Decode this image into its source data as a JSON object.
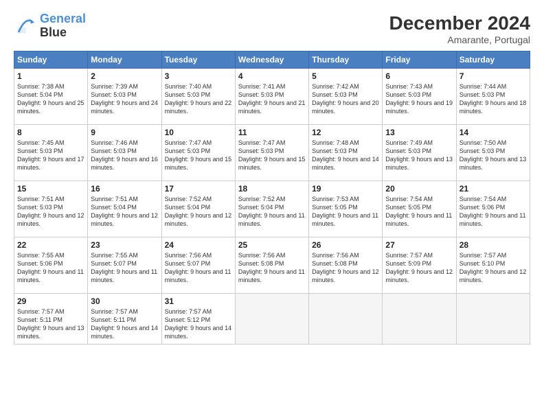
{
  "header": {
    "logo_line1": "General",
    "logo_line2": "Blue",
    "month": "December 2024",
    "location": "Amarante, Portugal"
  },
  "weekdays": [
    "Sunday",
    "Monday",
    "Tuesday",
    "Wednesday",
    "Thursday",
    "Friday",
    "Saturday"
  ],
  "weeks": [
    [
      {
        "day": "1",
        "sunrise": "7:38 AM",
        "sunset": "5:04 PM",
        "daylight": "9 hours and 25 minutes."
      },
      {
        "day": "2",
        "sunrise": "7:39 AM",
        "sunset": "5:03 PM",
        "daylight": "9 hours and 24 minutes."
      },
      {
        "day": "3",
        "sunrise": "7:40 AM",
        "sunset": "5:03 PM",
        "daylight": "9 hours and 22 minutes."
      },
      {
        "day": "4",
        "sunrise": "7:41 AM",
        "sunset": "5:03 PM",
        "daylight": "9 hours and 21 minutes."
      },
      {
        "day": "5",
        "sunrise": "7:42 AM",
        "sunset": "5:03 PM",
        "daylight": "9 hours and 20 minutes."
      },
      {
        "day": "6",
        "sunrise": "7:43 AM",
        "sunset": "5:03 PM",
        "daylight": "9 hours and 19 minutes."
      },
      {
        "day": "7",
        "sunrise": "7:44 AM",
        "sunset": "5:03 PM",
        "daylight": "9 hours and 18 minutes."
      }
    ],
    [
      {
        "day": "8",
        "sunrise": "7:45 AM",
        "sunset": "5:03 PM",
        "daylight": "9 hours and 17 minutes."
      },
      {
        "day": "9",
        "sunrise": "7:46 AM",
        "sunset": "5:03 PM",
        "daylight": "9 hours and 16 minutes."
      },
      {
        "day": "10",
        "sunrise": "7:47 AM",
        "sunset": "5:03 PM",
        "daylight": "9 hours and 15 minutes."
      },
      {
        "day": "11",
        "sunrise": "7:47 AM",
        "sunset": "5:03 PM",
        "daylight": "9 hours and 15 minutes."
      },
      {
        "day": "12",
        "sunrise": "7:48 AM",
        "sunset": "5:03 PM",
        "daylight": "9 hours and 14 minutes."
      },
      {
        "day": "13",
        "sunrise": "7:49 AM",
        "sunset": "5:03 PM",
        "daylight": "9 hours and 13 minutes."
      },
      {
        "day": "14",
        "sunrise": "7:50 AM",
        "sunset": "5:03 PM",
        "daylight": "9 hours and 13 minutes."
      }
    ],
    [
      {
        "day": "15",
        "sunrise": "7:51 AM",
        "sunset": "5:03 PM",
        "daylight": "9 hours and 12 minutes."
      },
      {
        "day": "16",
        "sunrise": "7:51 AM",
        "sunset": "5:04 PM",
        "daylight": "9 hours and 12 minutes."
      },
      {
        "day": "17",
        "sunrise": "7:52 AM",
        "sunset": "5:04 PM",
        "daylight": "9 hours and 12 minutes."
      },
      {
        "day": "18",
        "sunrise": "7:52 AM",
        "sunset": "5:04 PM",
        "daylight": "9 hours and 11 minutes."
      },
      {
        "day": "19",
        "sunrise": "7:53 AM",
        "sunset": "5:05 PM",
        "daylight": "9 hours and 11 minutes."
      },
      {
        "day": "20",
        "sunrise": "7:54 AM",
        "sunset": "5:05 PM",
        "daylight": "9 hours and 11 minutes."
      },
      {
        "day": "21",
        "sunrise": "7:54 AM",
        "sunset": "5:06 PM",
        "daylight": "9 hours and 11 minutes."
      }
    ],
    [
      {
        "day": "22",
        "sunrise": "7:55 AM",
        "sunset": "5:06 PM",
        "daylight": "9 hours and 11 minutes."
      },
      {
        "day": "23",
        "sunrise": "7:55 AM",
        "sunset": "5:07 PM",
        "daylight": "9 hours and 11 minutes."
      },
      {
        "day": "24",
        "sunrise": "7:56 AM",
        "sunset": "5:07 PM",
        "daylight": "9 hours and 11 minutes."
      },
      {
        "day": "25",
        "sunrise": "7:56 AM",
        "sunset": "5:08 PM",
        "daylight": "9 hours and 11 minutes."
      },
      {
        "day": "26",
        "sunrise": "7:56 AM",
        "sunset": "5:08 PM",
        "daylight": "9 hours and 12 minutes."
      },
      {
        "day": "27",
        "sunrise": "7:57 AM",
        "sunset": "5:09 PM",
        "daylight": "9 hours and 12 minutes."
      },
      {
        "day": "28",
        "sunrise": "7:57 AM",
        "sunset": "5:10 PM",
        "daylight": "9 hours and 12 minutes."
      }
    ],
    [
      {
        "day": "29",
        "sunrise": "7:57 AM",
        "sunset": "5:11 PM",
        "daylight": "9 hours and 13 minutes."
      },
      {
        "day": "30",
        "sunrise": "7:57 AM",
        "sunset": "5:11 PM",
        "daylight": "9 hours and 14 minutes."
      },
      {
        "day": "31",
        "sunrise": "7:57 AM",
        "sunset": "5:12 PM",
        "daylight": "9 hours and 14 minutes."
      },
      null,
      null,
      null,
      null
    ]
  ]
}
